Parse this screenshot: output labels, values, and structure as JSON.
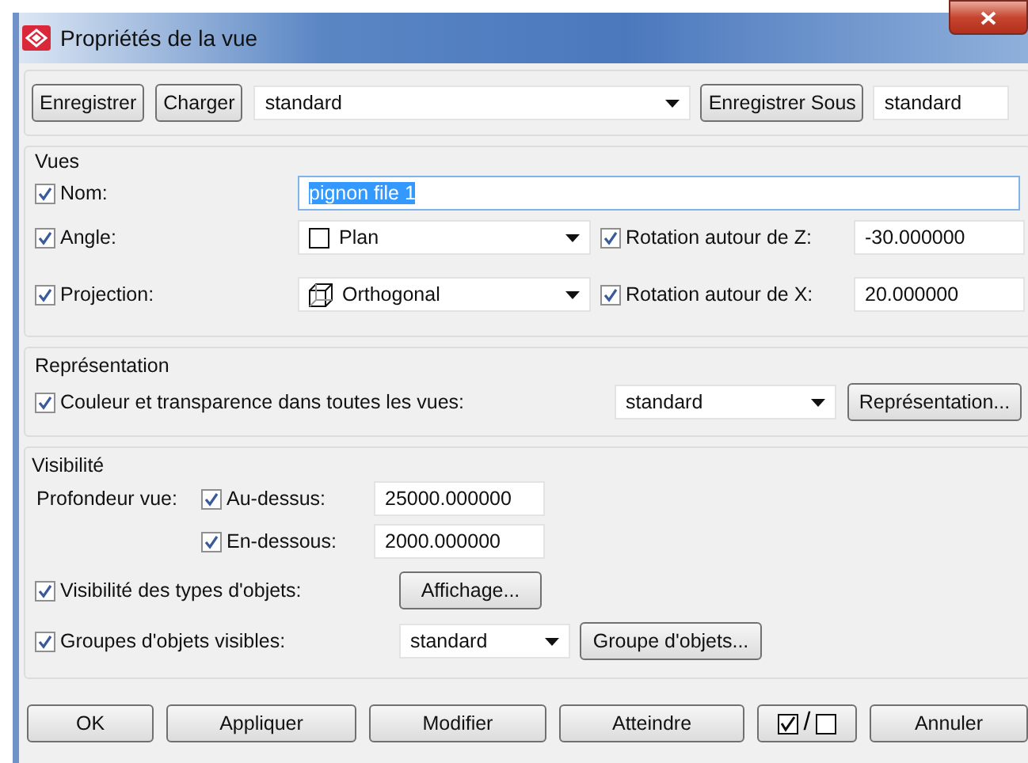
{
  "window": {
    "title": "Propriétés de la vue"
  },
  "toolbar": {
    "save_button": "Enregistrer",
    "load_button": "Charger",
    "preset": "standard",
    "save_as_button": "Enregistrer Sous",
    "save_as_name": "standard"
  },
  "views": {
    "title": "Vues",
    "name": {
      "label": "Nom:",
      "checked": true,
      "value": "pignon file 1",
      "text_selected": true
    },
    "rows": [
      {
        "label": "Angle:",
        "checked": true,
        "option": "Plan",
        "rotation_label": "Rotation autour de Z:",
        "rotation_checked": true,
        "rotation_value": "-30.000000"
      },
      {
        "label": "Projection:",
        "checked": true,
        "option": "Orthogonal",
        "rotation_label": "Rotation autour de X:",
        "rotation_checked": true,
        "rotation_value": "20.000000"
      }
    ]
  },
  "representation": {
    "title": "Représentation",
    "label": "Couleur et transparence dans toutes les vues:",
    "checked": true,
    "option": "standard",
    "button": "Représentation..."
  },
  "visibility": {
    "title": "Visibilité",
    "depth_label": "Profondeur vue:",
    "depth": [
      {
        "label": "Au-dessus:",
        "checked": true,
        "value": "25000.000000"
      },
      {
        "label": "En-dessous:",
        "checked": true,
        "value": "2000.000000"
      }
    ],
    "types": {
      "label": "Visibilité des types d'objets:",
      "checked": true,
      "button": "Affichage..."
    },
    "groups": {
      "label": "Groupes d'objets visibles:",
      "checked": true,
      "option": "standard",
      "button": "Groupe d'objets..."
    }
  },
  "footer": {
    "buttons": [
      "OK",
      "Appliquer",
      "Modifier",
      "Atteindre"
    ],
    "toggle_separator": "/",
    "cancel": "Annuler"
  }
}
